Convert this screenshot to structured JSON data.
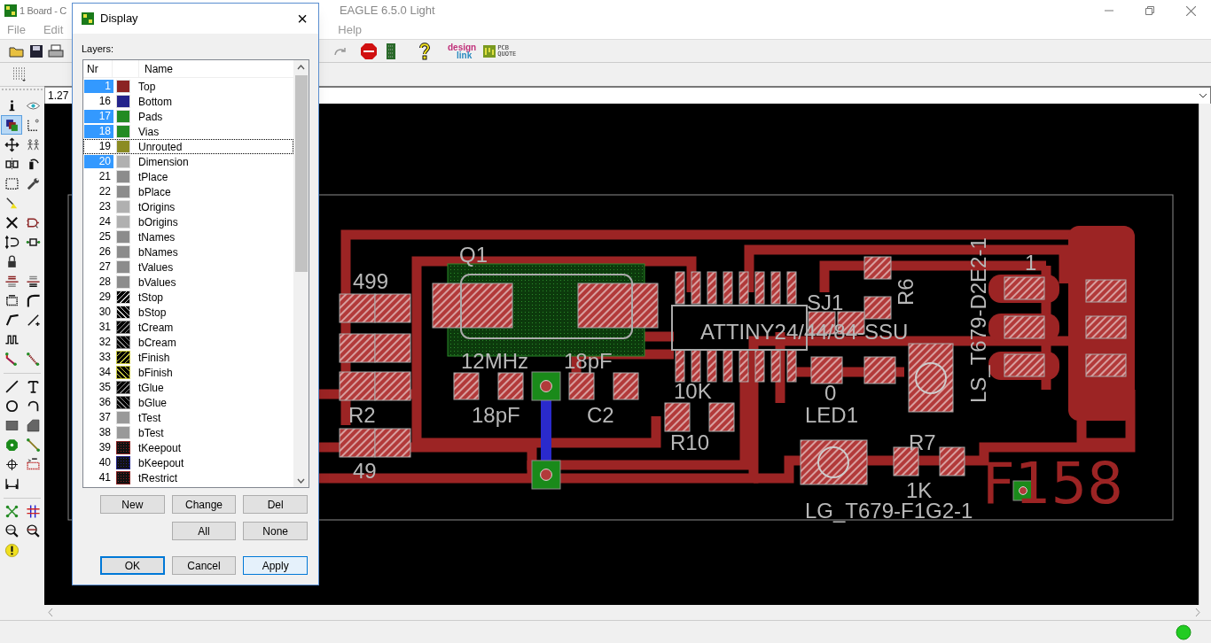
{
  "window": {
    "title_left": "1 Board - C",
    "title_right": "EAGLE 6.5.0 Light"
  },
  "menu": [
    {
      "label": "File"
    },
    {
      "label": "Edit"
    },
    {
      "label": "Help"
    }
  ],
  "toolbar_logos": [
    {
      "kind": "designlink",
      "line1": "design",
      "line2": "link"
    },
    {
      "kind": "pcbquote",
      "line1": "PCB",
      "line2": "QUOTE"
    }
  ],
  "zoom_field": {
    "value": "1.27"
  },
  "tools": [
    {
      "kind": "info",
      "selected": false
    },
    {
      "kind": "eye",
      "selected": false
    },
    {
      "kind": "layers",
      "selected": true
    },
    {
      "kind": "mark",
      "selected": false
    },
    {
      "kind": "move",
      "selected": false
    },
    {
      "kind": "group",
      "selected": false
    },
    {
      "kind": "mirror",
      "selected": false
    },
    {
      "kind": "rotate",
      "selected": false
    },
    {
      "kind": "select",
      "selected": false
    },
    {
      "kind": "wrench",
      "selected": false
    },
    {
      "kind": "paint",
      "selected": false
    },
    {
      "kind": "gap"
    },
    {
      "kind": "delete",
      "selected": false
    },
    {
      "kind": "gateswap",
      "selected": false
    },
    {
      "kind": "pinswap",
      "selected": false
    },
    {
      "kind": "replace",
      "selected": false
    },
    {
      "kind": "lock",
      "selected": false
    },
    {
      "kind": "gap"
    },
    {
      "kind": "name",
      "selected": false
    },
    {
      "kind": "value",
      "selected": false
    },
    {
      "kind": "smash",
      "selected": false
    },
    {
      "kind": "miter",
      "selected": false
    },
    {
      "kind": "split",
      "selected": false
    },
    {
      "kind": "optimize",
      "selected": false
    },
    {
      "kind": "meander",
      "selected": false
    },
    {
      "kind": "gap"
    },
    {
      "kind": "route",
      "selected": false
    },
    {
      "kind": "ripup",
      "selected": false
    },
    {
      "kind": "separator"
    },
    {
      "kind": "wire",
      "selected": false
    },
    {
      "kind": "text",
      "selected": false
    },
    {
      "kind": "circle",
      "selected": false
    },
    {
      "kind": "arc",
      "selected": false
    },
    {
      "kind": "rect",
      "selected": false
    },
    {
      "kind": "polygon",
      "selected": false
    },
    {
      "kind": "via",
      "selected": false
    },
    {
      "kind": "signal",
      "selected": false
    },
    {
      "kind": "hole",
      "selected": false
    },
    {
      "kind": "attribute",
      "selected": false
    },
    {
      "kind": "dimension",
      "selected": false
    },
    {
      "kind": "gap"
    },
    {
      "kind": "separator"
    },
    {
      "kind": "ratsnest",
      "selected": false
    },
    {
      "kind": "autorouter",
      "selected": false
    },
    {
      "kind": "erc",
      "selected": false
    },
    {
      "kind": "drc",
      "selected": false
    },
    {
      "kind": "errors",
      "selected": false
    }
  ],
  "pcb": {
    "labels": [
      "LS_T679-D2E2-1",
      "Q1",
      "1",
      "499",
      "R6",
      "SJ1",
      "ATTINY24/44/84-SSU",
      "12MHz",
      "18pF",
      "10K",
      "0",
      "R2",
      "18pF",
      "C2",
      "LED1",
      "R10",
      "R7",
      "49",
      "1K",
      "LG_T679-F1G2-1"
    ],
    "copper_text": "F158"
  },
  "dialog": {
    "title": "Display",
    "close": "×",
    "layers_label": "Layers:",
    "columns": [
      "Nr",
      "Name"
    ],
    "layers": [
      {
        "nr": "1",
        "name": "Top",
        "kind": "solid",
        "color": "#8b2323",
        "selected": true,
        "focused": false
      },
      {
        "nr": "16",
        "name": "Bottom",
        "kind": "solid",
        "color": "#23238b",
        "selected": false,
        "focused": false
      },
      {
        "nr": "17",
        "name": "Pads",
        "kind": "solid",
        "color": "#238b23",
        "selected": true,
        "focused": false
      },
      {
        "nr": "18",
        "name": "Vias",
        "kind": "solid",
        "color": "#238b23",
        "selected": true,
        "focused": false
      },
      {
        "nr": "19",
        "name": "Unrouted",
        "kind": "solid",
        "color": "#8b8b23",
        "selected": false,
        "focused": true
      },
      {
        "nr": "20",
        "name": "Dimension",
        "kind": "solid",
        "color": "#b0b0b0",
        "selected": true,
        "focused": false
      },
      {
        "nr": "21",
        "name": "tPlace",
        "kind": "solid",
        "color": "#8c8c8c",
        "selected": false,
        "focused": false
      },
      {
        "nr": "22",
        "name": "bPlace",
        "kind": "solid",
        "color": "#8c8c8c",
        "selected": false,
        "focused": false
      },
      {
        "nr": "23",
        "name": "tOrigins",
        "kind": "solid",
        "color": "#b0b0b0",
        "selected": false,
        "focused": false
      },
      {
        "nr": "24",
        "name": "bOrigins",
        "kind": "solid",
        "color": "#b0b0b0",
        "selected": false,
        "focused": false
      },
      {
        "nr": "25",
        "name": "tNames",
        "kind": "solid",
        "color": "#8c8c8c",
        "selected": false,
        "focused": false
      },
      {
        "nr": "26",
        "name": "bNames",
        "kind": "solid",
        "color": "#8c8c8c",
        "selected": false,
        "focused": false
      },
      {
        "nr": "27",
        "name": "tValues",
        "kind": "solid",
        "color": "#8c8c8c",
        "selected": false,
        "focused": false
      },
      {
        "nr": "28",
        "name": "bValues",
        "kind": "solid",
        "color": "#8c8c8c",
        "selected": false,
        "focused": false
      },
      {
        "nr": "29",
        "name": "tStop",
        "kind": "hatch",
        "color": "#d0d0d0",
        "selected": false,
        "focused": false
      },
      {
        "nr": "30",
        "name": "bStop",
        "kind": "backhatch",
        "color": "#d0d0d0",
        "selected": false,
        "focused": false
      },
      {
        "nr": "31",
        "name": "tCream",
        "kind": "hatch",
        "color": "#8c8c8c",
        "selected": false,
        "focused": false
      },
      {
        "nr": "32",
        "name": "bCream",
        "kind": "backhatch",
        "color": "#8c8c8c",
        "selected": false,
        "focused": false
      },
      {
        "nr": "33",
        "name": "tFinish",
        "kind": "hatch",
        "color": "#c8c840",
        "selected": false,
        "focused": false
      },
      {
        "nr": "34",
        "name": "bFinish",
        "kind": "backhatch",
        "color": "#c8c840",
        "selected": false,
        "focused": false
      },
      {
        "nr": "35",
        "name": "tGlue",
        "kind": "hatch",
        "color": "#8c8c8c",
        "selected": false,
        "focused": false
      },
      {
        "nr": "36",
        "name": "bGlue",
        "kind": "backhatch",
        "color": "#8c8c8c",
        "selected": false,
        "focused": false
      },
      {
        "nr": "37",
        "name": "tTest",
        "kind": "solid",
        "color": "#999999",
        "selected": false,
        "focused": false
      },
      {
        "nr": "38",
        "name": "bTest",
        "kind": "solid",
        "color": "#999999",
        "selected": false,
        "focused": false
      },
      {
        "nr": "39",
        "name": "tKeepout",
        "kind": "dots",
        "color": "#8b2323",
        "selected": false,
        "focused": false
      },
      {
        "nr": "40",
        "name": "bKeepout",
        "kind": "dots",
        "color": "#23238b",
        "selected": false,
        "focused": false
      },
      {
        "nr": "41",
        "name": "tRestrict",
        "kind": "dots",
        "color": "#8b2323",
        "selected": false,
        "focused": false
      }
    ],
    "buttons": [
      {
        "label": "New",
        "kind": "normal"
      },
      {
        "label": "Change",
        "kind": "normal"
      },
      {
        "label": "Del",
        "kind": "normal"
      },
      {
        "label": "All",
        "kind": "normal"
      },
      {
        "label": "None",
        "kind": "normal"
      },
      {
        "label": "OK",
        "kind": "default"
      },
      {
        "label": "Cancel",
        "kind": "normal"
      },
      {
        "label": "Apply",
        "kind": "hover"
      }
    ]
  }
}
